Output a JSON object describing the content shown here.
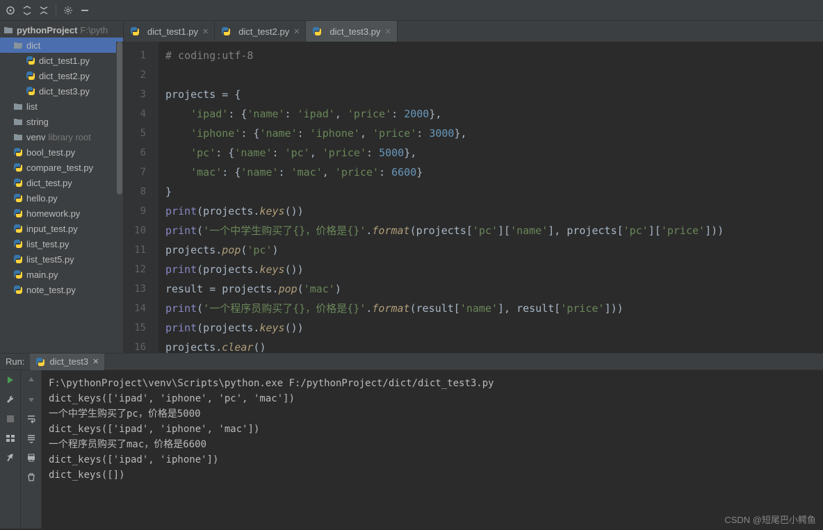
{
  "project": {
    "name": "pythonProject",
    "path_hint": "F:\\pyth",
    "tree": [
      {
        "label": "dict",
        "type": "folder-open",
        "indent": 1
      },
      {
        "label": "dict_test1.py",
        "type": "py",
        "indent": 2
      },
      {
        "label": "dict_test2.py",
        "type": "py",
        "indent": 2
      },
      {
        "label": "dict_test3.py",
        "type": "py",
        "indent": 2
      },
      {
        "label": "list",
        "type": "folder",
        "indent": 1
      },
      {
        "label": "string",
        "type": "folder",
        "indent": 1
      },
      {
        "label": "venv",
        "type": "folder",
        "indent": 1,
        "hint": "library root"
      },
      {
        "label": "bool_test.py",
        "type": "py",
        "indent": 1
      },
      {
        "label": "compare_test.py",
        "type": "py",
        "indent": 1
      },
      {
        "label": "dict_test.py",
        "type": "py",
        "indent": 1
      },
      {
        "label": "hello.py",
        "type": "py",
        "indent": 1
      },
      {
        "label": "homework.py",
        "type": "py",
        "indent": 1
      },
      {
        "label": "input_test.py",
        "type": "py",
        "indent": 1
      },
      {
        "label": "list_test.py",
        "type": "py",
        "indent": 1
      },
      {
        "label": "list_test5.py",
        "type": "py",
        "indent": 1
      },
      {
        "label": "main.py",
        "type": "py",
        "indent": 1
      },
      {
        "label": "note_test.py",
        "type": "py",
        "indent": 1
      }
    ]
  },
  "tabs": [
    {
      "label": "dict_test1.py",
      "active": false
    },
    {
      "label": "dict_test2.py",
      "active": false
    },
    {
      "label": "dict_test3.py",
      "active": true
    }
  ],
  "editor": {
    "first_line": 1,
    "lines": [
      {
        "n": 1,
        "html": "<span class='k-cmt'># coding:utf-8</span>"
      },
      {
        "n": 2,
        "html": ""
      },
      {
        "n": 3,
        "html": "projects = {"
      },
      {
        "n": 4,
        "html": "    <span class='k-str'>'ipad'</span>: {<span class='k-str'>'name'</span>: <span class='k-str'>'ipad'</span>, <span class='k-str'>'price'</span>: <span class='k-num'>2000</span>},"
      },
      {
        "n": 5,
        "html": "    <span class='k-str'>'iphone'</span>: {<span class='k-str'>'name'</span>: <span class='k-str'>'iphone'</span>, <span class='k-str'>'price'</span>: <span class='k-num'>3000</span>},"
      },
      {
        "n": 6,
        "html": "    <span class='k-str'>'pc'</span>: {<span class='k-str'>'name'</span>: <span class='k-str'>'pc'</span>, <span class='k-str'>'price'</span>: <span class='k-num'>5000</span>},"
      },
      {
        "n": 7,
        "html": "    <span class='k-str'>'mac'</span>: {<span class='k-str'>'name'</span>: <span class='k-str'>'mac'</span>, <span class='k-str'>'price'</span>: <span class='k-num'>6600</span>}"
      },
      {
        "n": 8,
        "html": "}"
      },
      {
        "n": 9,
        "html": "<span class='k-builtin'>print</span>(projects.<span class='k-fn'>keys</span>())"
      },
      {
        "n": 10,
        "html": "<span class='k-builtin'>print</span>(<span class='k-str'>'一个中学生购买了{}，价格是{}'</span>.<span class='k-fn'>format</span>(projects[<span class='k-str'>'pc'</span>][<span class='k-str'>'name'</span>], projects[<span class='k-str'>'pc'</span>][<span class='k-str'>'price'</span>]))"
      },
      {
        "n": 11,
        "html": "projects.<span class='k-fn'>pop</span>(<span class='k-str'>'pc'</span>)"
      },
      {
        "n": 12,
        "html": "<span class='k-builtin'>print</span>(projects.<span class='k-fn'>keys</span>())"
      },
      {
        "n": 13,
        "html": "result = projects.<span class='k-fn'>pop</span>(<span class='k-str'>'mac'</span>)"
      },
      {
        "n": 14,
        "html": "<span class='k-builtin'>print</span>(<span class='k-str'>'一个程序员购买了{}，价格是{}'</span>.<span class='k-fn'>format</span>(result[<span class='k-str'>'name'</span>], result[<span class='k-str'>'price'</span>]))"
      },
      {
        "n": 15,
        "html": "<span class='k-builtin'>print</span>(projects.<span class='k-fn'>keys</span>())"
      },
      {
        "n": 16,
        "html": "projects.<span class='k-fn'>clear</span>()"
      }
    ]
  },
  "run": {
    "label": "Run:",
    "tab_name": "dict_test3",
    "output": [
      "F:\\pythonProject\\venv\\Scripts\\python.exe F:/pythonProject/dict/dict_test3.py",
      "dict_keys(['ipad', 'iphone', 'pc', 'mac'])",
      "一个中学生购买了pc，价格是5000",
      "dict_keys(['ipad', 'iphone', 'mac'])",
      "一个程序员购买了mac，价格是6600",
      "dict_keys(['ipad', 'iphone'])",
      "dict_keys([])"
    ]
  },
  "watermark": "CSDN @短尾巴小鳄鱼"
}
